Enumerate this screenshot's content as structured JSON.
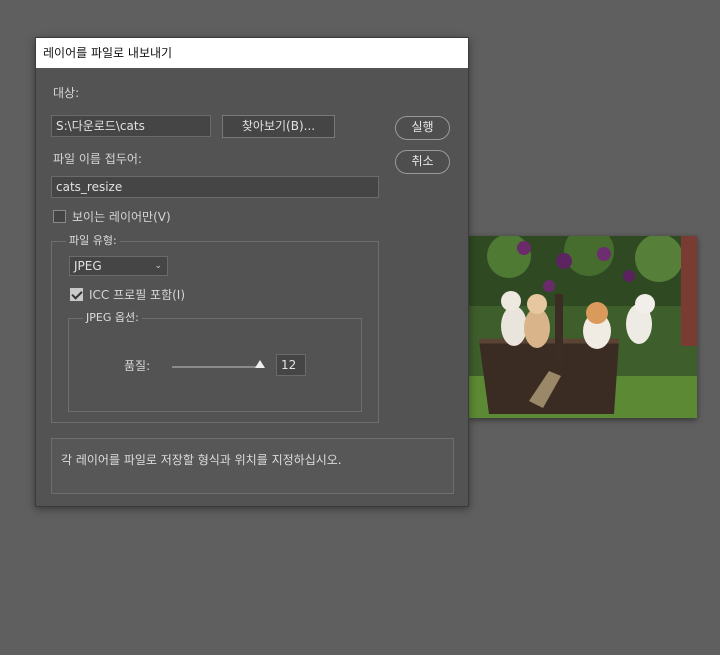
{
  "dialog": {
    "title": "레이어를 파일로 내보내기",
    "destination_label": "대상:",
    "destination_value": "S:\\다운로드\\cats",
    "browse_label": "찾아보기(B)...",
    "run_label": "실행",
    "cancel_label": "취소",
    "prefix_label": "파일 이름 접두어:",
    "prefix_value": "cats_resize",
    "visible_only_label": "보이는 레이어만(V)",
    "visible_only_checked": false,
    "file_type_group": "파일 유형:",
    "file_type_value": "JPEG",
    "icc_label": "ICC 프로필 포함(I)",
    "icc_checked": true,
    "jpeg_options_group": "JPEG 옵션:",
    "quality_label": "품질:",
    "quality_value": "12",
    "quality_max": 12,
    "description": "각 레이어를 파일로 저장할 형식과 위치를 지정하십시오."
  },
  "icons": {
    "dropdown": "chevron-down-icon",
    "checkbox_checked": "checkmark-icon",
    "slider_thumb": "triangle-icon"
  },
  "background_image": "kittens-in-basket-photo"
}
